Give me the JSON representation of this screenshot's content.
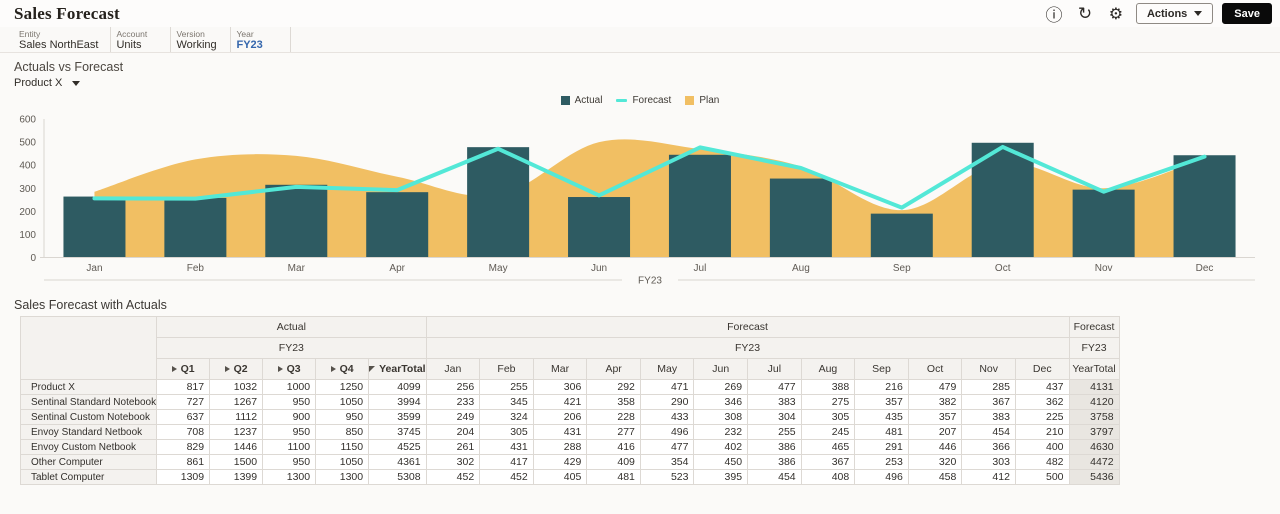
{
  "app": {
    "title": "Sales Forecast"
  },
  "header": {
    "actions_label": "Actions",
    "save_label": "Save",
    "icons": [
      "info-icon",
      "refresh-icon",
      "settings-icon"
    ],
    "save_color": "#0a0a0a"
  },
  "pov": {
    "items": [
      {
        "label": "Entity",
        "value": "Sales NorthEast",
        "link": false
      },
      {
        "label": "Account",
        "value": "Units",
        "link": false
      },
      {
        "label": "Version",
        "value": "Working",
        "link": false
      },
      {
        "label": "Year",
        "value": "FY23",
        "link": true
      }
    ]
  },
  "chart_section": {
    "title": "Actuals vs Forecast",
    "selector": "Product X"
  },
  "chart_data": {
    "type": "combo",
    "x": [
      "Jan",
      "Feb",
      "Mar",
      "Apr",
      "May",
      "Jun",
      "Jul",
      "Aug",
      "Sep",
      "Oct",
      "Nov",
      "Dec"
    ],
    "series": [
      {
        "name": "Plan",
        "type": "area",
        "marker": "square",
        "color": "#f1bf63",
        "values": [
          285,
          425,
          440,
          350,
          270,
          500,
          470,
          395,
          205,
          410,
          300,
          430
        ]
      },
      {
        "name": "Actual",
        "type": "bar",
        "marker": "square",
        "color": "#2e5b62",
        "values": [
          264,
          258,
          315,
          283,
          478,
          262,
          445,
          342,
          190,
          497,
          294,
          443
        ]
      },
      {
        "name": "Forecast",
        "type": "line",
        "marker": "line",
        "color": "#53e8d7",
        "values": [
          256,
          255,
          306,
          292,
          471,
          269,
          477,
          388,
          216,
          479,
          285,
          437
        ]
      }
    ],
    "legend_order": [
      "Actual",
      "Forecast",
      "Plan"
    ],
    "ylim": [
      0,
      600
    ],
    "yticks": [
      0,
      100,
      200,
      300,
      400,
      500,
      600
    ],
    "xlabel": "FY23",
    "legend_position": "top",
    "grid": false
  },
  "table": {
    "title": "Sales Forecast with Actuals",
    "groups": [
      {
        "label": "Actual",
        "sublabel": "FY23",
        "span": 5
      },
      {
        "label": "Forecast",
        "sublabel": "FY23",
        "span": 12
      },
      {
        "label": "Forecast",
        "sublabel": "FY23",
        "span": 1
      }
    ],
    "columns": [
      {
        "label": "Q1",
        "icon": "collapsed",
        "bold": true
      },
      {
        "label": "Q2",
        "icon": "collapsed",
        "bold": true
      },
      {
        "label": "Q3",
        "icon": "collapsed",
        "bold": true
      },
      {
        "label": "Q4",
        "icon": "collapsed",
        "bold": true
      },
      {
        "label": "YearTotal",
        "icon": "expanded",
        "bold": true
      },
      {
        "label": "Jan"
      },
      {
        "label": "Feb"
      },
      {
        "label": "Mar"
      },
      {
        "label": "Apr"
      },
      {
        "label": "May"
      },
      {
        "label": "Jun"
      },
      {
        "label": "Jul"
      },
      {
        "label": "Aug"
      },
      {
        "label": "Sep"
      },
      {
        "label": "Oct"
      },
      {
        "label": "Nov"
      },
      {
        "label": "Dec"
      },
      {
        "label": "YearTotal",
        "total": true
      }
    ],
    "rows": [
      {
        "name": "Product X",
        "values": [
          817,
          1032,
          1000,
          1250,
          4099,
          256,
          255,
          306,
          292,
          471,
          269,
          477,
          388,
          216,
          479,
          285,
          437,
          4131
        ]
      },
      {
        "name": "Sentinal Standard Notebook",
        "values": [
          727,
          1267,
          950,
          1050,
          3994,
          233,
          345,
          421,
          358,
          290,
          346,
          383,
          275,
          357,
          382,
          367,
          362,
          4120
        ]
      },
      {
        "name": "Sentinal Custom Notebook",
        "values": [
          637,
          1112,
          900,
          950,
          3599,
          249,
          324,
          206,
          228,
          433,
          308,
          304,
          305,
          435,
          357,
          383,
          225,
          3758
        ]
      },
      {
        "name": "Envoy Standard Netbook",
        "values": [
          708,
          1237,
          950,
          850,
          3745,
          204,
          305,
          431,
          277,
          496,
          232,
          255,
          245,
          481,
          207,
          454,
          210,
          3797
        ]
      },
      {
        "name": "Envoy Custom Netbook",
        "values": [
          829,
          1446,
          1100,
          1150,
          4525,
          261,
          431,
          288,
          416,
          477,
          402,
          386,
          465,
          291,
          446,
          366,
          400,
          4630
        ]
      },
      {
        "name": "Other Computer",
        "values": [
          861,
          1500,
          950,
          1050,
          4361,
          302,
          417,
          429,
          409,
          354,
          450,
          386,
          367,
          253,
          320,
          303,
          482,
          4472
        ]
      },
      {
        "name": "Tablet Computer",
        "values": [
          1309,
          1399,
          1300,
          1300,
          5308,
          452,
          452,
          405,
          481,
          523,
          395,
          454,
          408,
          496,
          458,
          412,
          500,
          5436
        ]
      }
    ]
  }
}
